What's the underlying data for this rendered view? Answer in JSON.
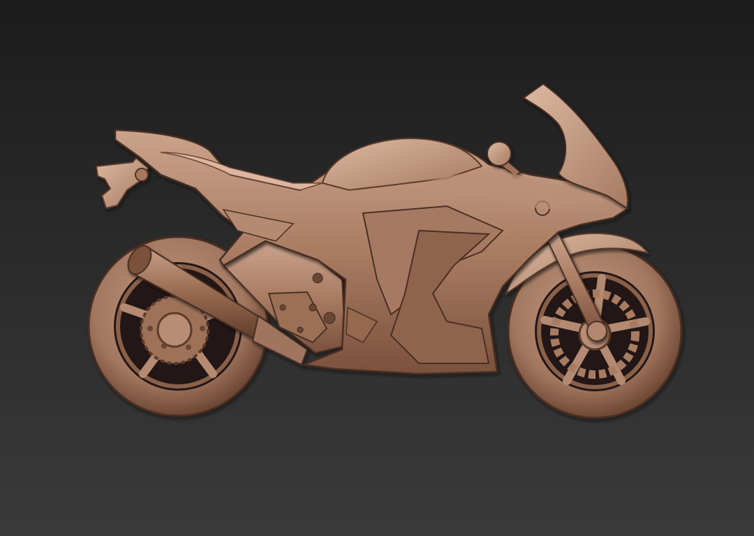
{
  "scene": {
    "subject_icon": "motorcycle-wood-relief",
    "colors": {
      "background_top": "#1c1c1c",
      "background_bottom": "#3a3a3a",
      "wood_light": "#c9a088",
      "wood_mid": "#a87a62",
      "wood_dark": "#6b4634",
      "wood_shadow": "#3f271c"
    }
  }
}
